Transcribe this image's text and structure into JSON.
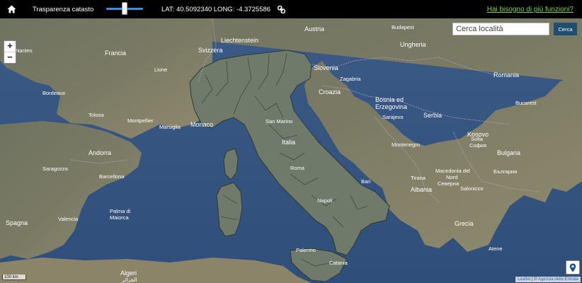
{
  "toolbar": {
    "home_icon": "home-icon",
    "transparency_label": "Trasparenza catasto",
    "transparency_value": 0.5,
    "coords": "LAT: 40.5092340 LONG: -4.3725586",
    "link_icon": "link-icon",
    "help_link": "Hai bisogno di più funzioni?",
    "help_color": "#7bd24a"
  },
  "map": {
    "zoom_in": "+",
    "zoom_out": "−",
    "search_placeholder": "Cerca località",
    "search_button": "Cerca",
    "scale": "100 km",
    "attribution_leaflet": "Leaflet",
    "attribution_sep": " | © ",
    "attribution_source": "Agenzia delle Entrate",
    "locate_icon": "map-marker-icon",
    "labels": {
      "austria": "Austria",
      "liechtenstein": "Liechtenstein",
      "svizzera": "Svizzera",
      "francia": "Francia",
      "slovenia": "Slovenia",
      "croazia": "Croazia",
      "ungheria": "Ungheria",
      "romania": "Romania",
      "bosnia1": "Bosnia ed",
      "bosnia2": "Erzegovina",
      "serbia": "Serbia",
      "italia": "Italia",
      "monaco": "Monaco",
      "andorra": "Andorra",
      "spagna": "Spagna",
      "montenegro": "Montenegro",
      "kosovo": "Kosovo",
      "bulgaria": "Bulgaria",
      "bulgaria_cyr": "България",
      "macedonia1": "Macedonia del",
      "macedonia2": "Nord",
      "macedonia_cyr": "Северна",
      "albania": "Albania",
      "grecia": "Grecia",
      "algeria1": "Algeri",
      "algeria2": "الجزائر",
      "san_marino": "San Marino",
      "budapest": "Budapest",
      "bucarest": "Bucarest",
      "sofia": "Sofia",
      "sofia_cyr": "София",
      "sarajevo": "Sarajevo",
      "zagabria": "Zagabria",
      "barcelona": "Barcellona",
      "palma1": "Palma di",
      "palma2": "Maiorca",
      "valencia": "Valencia",
      "bari": "Bari",
      "tirana": "Tirana",
      "napoli": "Napoli",
      "roma": "Roma",
      "palermo": "Palermo",
      "catania": "Catania",
      "saragozza": "Saragozza",
      "lione": "Lione",
      "bordeaux": "Bordeaux",
      "tolosa": "Tolosa",
      "montpellier": "Montpellier",
      "marsiglia": "Marsiglia",
      "nantes": "Nantes",
      "salonicco": "Salonicco",
      "atene": "Atene"
    }
  }
}
